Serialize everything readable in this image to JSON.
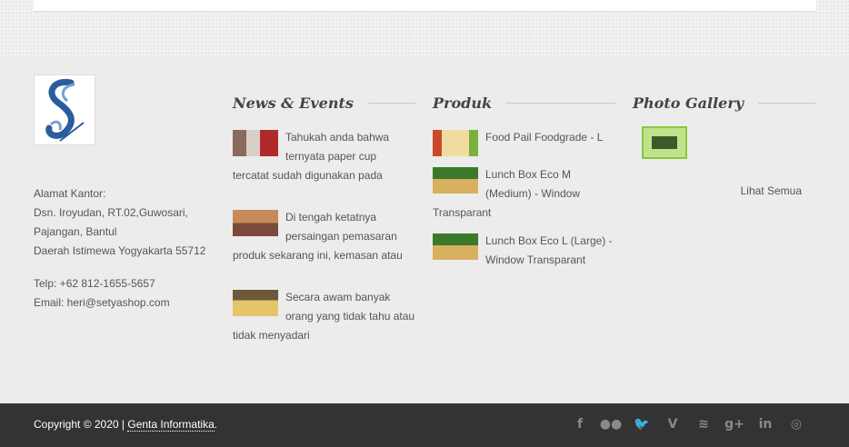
{
  "contact": {
    "label": "Alamat Kantor:",
    "address1": "Dsn. Iroyudan, RT.02,Guwosari,",
    "address2": "Pajangan, Bantul",
    "address3": "Daerah Istimewa Yogyakarta 55712",
    "phone": "Telp: +62 812-1655-5657",
    "email": "Email: heri@setyashop.com"
  },
  "news": {
    "title": "News & Events",
    "items": [
      {
        "text": "Tahukah anda bahwa ternyata paper cup tercatat sudah digunakan pada"
      },
      {
        "text": "Di tengah ketatnya persaingan pemasaran produk sekarang ini, kemasan atau"
      },
      {
        "text": "Secara awam banyak orang yang tidak tahu atau tidak menyadari"
      }
    ]
  },
  "products": {
    "title": "Produk",
    "items": [
      {
        "text": "Food Pail Foodgrade - L"
      },
      {
        "text": "Lunch Box Eco M (Medium) - Window Transparant"
      },
      {
        "text": "Lunch Box Eco L (Large) - Window Transparant"
      }
    ]
  },
  "gallery": {
    "title": "Photo Gallery",
    "see_all": "Lihat Semua"
  },
  "bottom": {
    "copyright": "Copyright © 2020 |",
    "company": "Genta Informatika",
    "period": "."
  },
  "social_icons": [
    "facebook-icon",
    "flickr-icon",
    "twitter-icon",
    "vimeo-icon",
    "rss-icon",
    "google-plus-icon",
    "linkedin-icon",
    "dribbble-icon"
  ]
}
